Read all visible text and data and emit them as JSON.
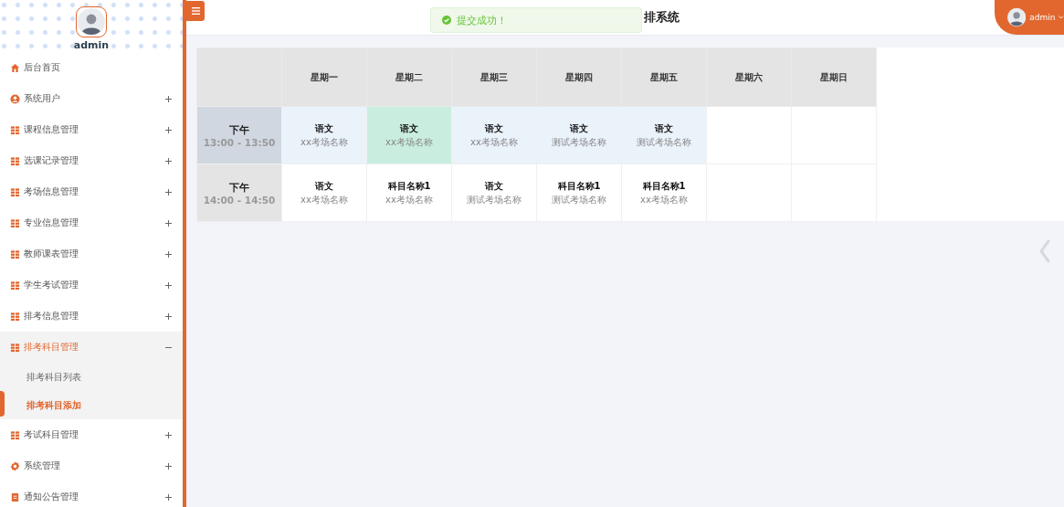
{
  "sidebar": {
    "user": "admin",
    "items": [
      {
        "label": "后台首页",
        "kind": "home",
        "expanded": false
      },
      {
        "label": "系统用户",
        "kind": "user",
        "expanded": false
      },
      {
        "label": "课程信息管理",
        "kind": "grid",
        "expanded": false
      },
      {
        "label": "选课记录管理",
        "kind": "grid",
        "expanded": false
      },
      {
        "label": "考场信息管理",
        "kind": "grid",
        "expanded": false
      },
      {
        "label": "专业信息管理",
        "kind": "grid",
        "expanded": false
      },
      {
        "label": "教师课表管理",
        "kind": "grid",
        "expanded": false
      },
      {
        "label": "学生考试管理",
        "kind": "grid",
        "expanded": false
      },
      {
        "label": "排考信息管理",
        "kind": "grid",
        "expanded": false
      },
      {
        "label": "排考科目管理",
        "kind": "grid",
        "expanded": true,
        "children": [
          {
            "label": "排考科目列表",
            "selected": false
          },
          {
            "label": "排考科目添加",
            "selected": true
          }
        ]
      },
      {
        "label": "考试科目管理",
        "kind": "grid",
        "expanded": false
      },
      {
        "label": "系统管理",
        "kind": "gear",
        "expanded": false
      },
      {
        "label": "通知公告管理",
        "kind": "doc",
        "expanded": false
      }
    ]
  },
  "header": {
    "title": "排系统",
    "user": "admin"
  },
  "toast": {
    "message": "提交成功！"
  },
  "schedule": {
    "days": [
      "星期一",
      "星期二",
      "星期三",
      "星期四",
      "星期五",
      "星期六",
      "星期日"
    ],
    "rows": [
      {
        "period": "下午",
        "time": "13:00 - 13:50",
        "highlighted": true,
        "cells": [
          {
            "subject": "语文",
            "room": "xx考场名称",
            "hovered": false
          },
          {
            "subject": "语文",
            "room": "xx考场名称",
            "hovered": true
          },
          {
            "subject": "语文",
            "room": "xx考场名称",
            "hovered": false
          },
          {
            "subject": "语文",
            "room": "测试考场名称",
            "hovered": false
          },
          {
            "subject": "语文",
            "room": "测试考场名称",
            "hovered": false
          }
        ]
      },
      {
        "period": "下午",
        "time": "14:00 - 14:50",
        "highlighted": false,
        "cells": [
          {
            "subject": "语文",
            "room": "xx考场名称",
            "hovered": false
          },
          {
            "subject": "科目名称1",
            "room": "xx考场名称",
            "hovered": false
          },
          {
            "subject": "语文",
            "room": "测试考场名称",
            "hovered": false
          },
          {
            "subject": "科目名称1",
            "room": "测试考场名称",
            "hovered": false
          },
          {
            "subject": "科目名称1",
            "room": "xx考场名称",
            "hovered": false
          }
        ]
      }
    ]
  }
}
